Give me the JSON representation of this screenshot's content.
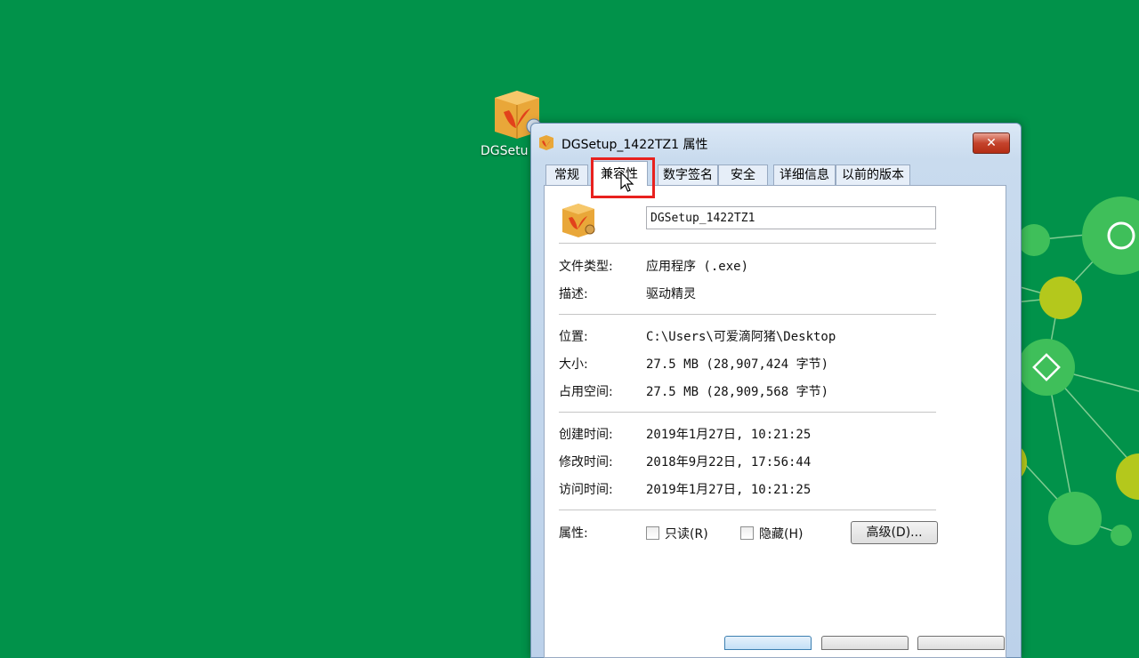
{
  "desktop": {
    "icon_label": "DGSetu"
  },
  "window": {
    "title": "DGSetup_1422TZ1 属性",
    "close_label": "✕",
    "tabs": [
      {
        "label": "常规"
      },
      {
        "label": "兼容性"
      },
      {
        "label": "数字签名"
      },
      {
        "label": "安全"
      },
      {
        "label": "详细信息"
      },
      {
        "label": "以前的版本"
      }
    ],
    "active_tab": "兼容性"
  },
  "general": {
    "file_name": "DGSetup_1422TZ1",
    "file_type_label": "文件类型:",
    "file_type_value": "应用程序 (.exe)",
    "description_label": "描述:",
    "description_value": "驱动精灵",
    "location_label": "位置:",
    "location_value": "C:\\Users\\可爱滴阿猪\\Desktop",
    "size_label": "大小:",
    "size_value": "27.5 MB (28,907,424 字节)",
    "size_on_disk_label": "占用空间:",
    "size_on_disk_value": "27.5 MB (28,909,568 字节)",
    "created_label": "创建时间:",
    "created_value": "2019年1月27日, 10:21:25",
    "modified_label": "修改时间:",
    "modified_value": "2018年9月22日, 17:56:44",
    "accessed_label": "访问时间:",
    "accessed_value": "2019年1月27日, 10:21:25",
    "attributes_label": "属性:",
    "readonly_label": "只读(R)",
    "hidden_label": "隐藏(H)",
    "advanced_label": "高级(D)..."
  },
  "colors": {
    "desktop_bg": "#01924a",
    "highlight": "#e8211e"
  }
}
